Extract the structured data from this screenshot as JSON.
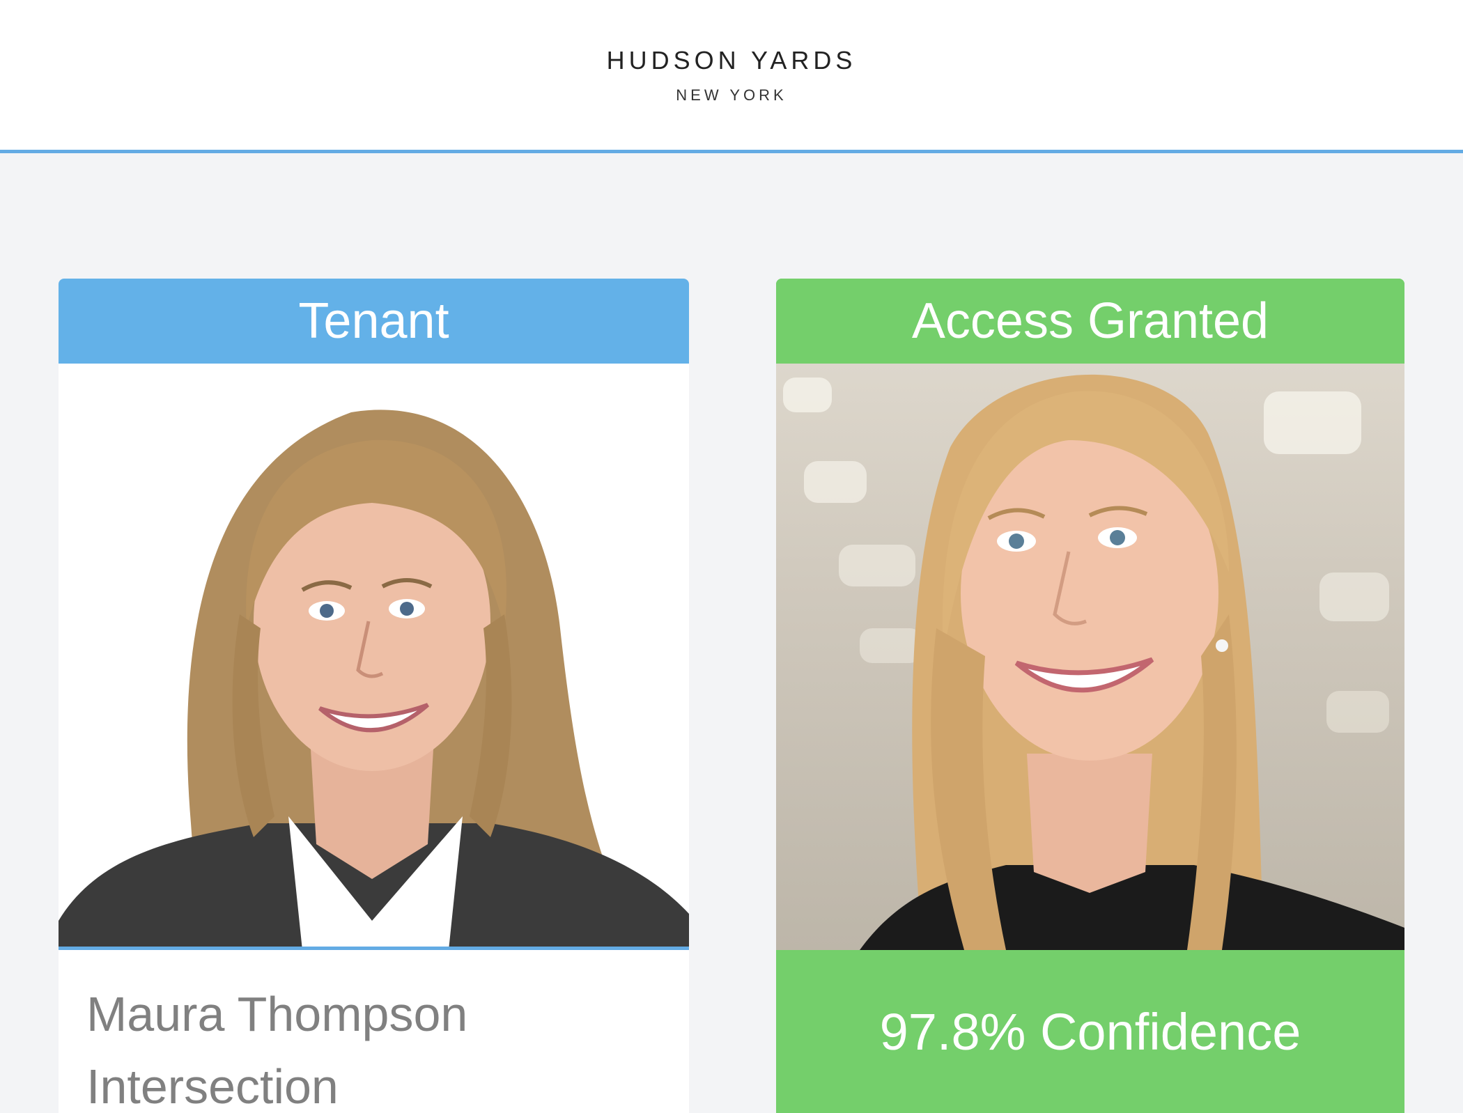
{
  "header": {
    "logo_main": "HUDSON YARDS",
    "logo_sub": "NEW YORK"
  },
  "tenant_card": {
    "title": "Tenant",
    "photo_icon": "person-portrait",
    "name": "Maura Thompson",
    "company": "Intersection"
  },
  "result_card": {
    "title": "Access Granted",
    "photo_icon": "person-portrait",
    "confidence": "97.8% Confidence"
  },
  "colors": {
    "tenant_accent": "#63b1e8",
    "granted_accent": "#74cf6b",
    "background": "#f3f4f6"
  }
}
